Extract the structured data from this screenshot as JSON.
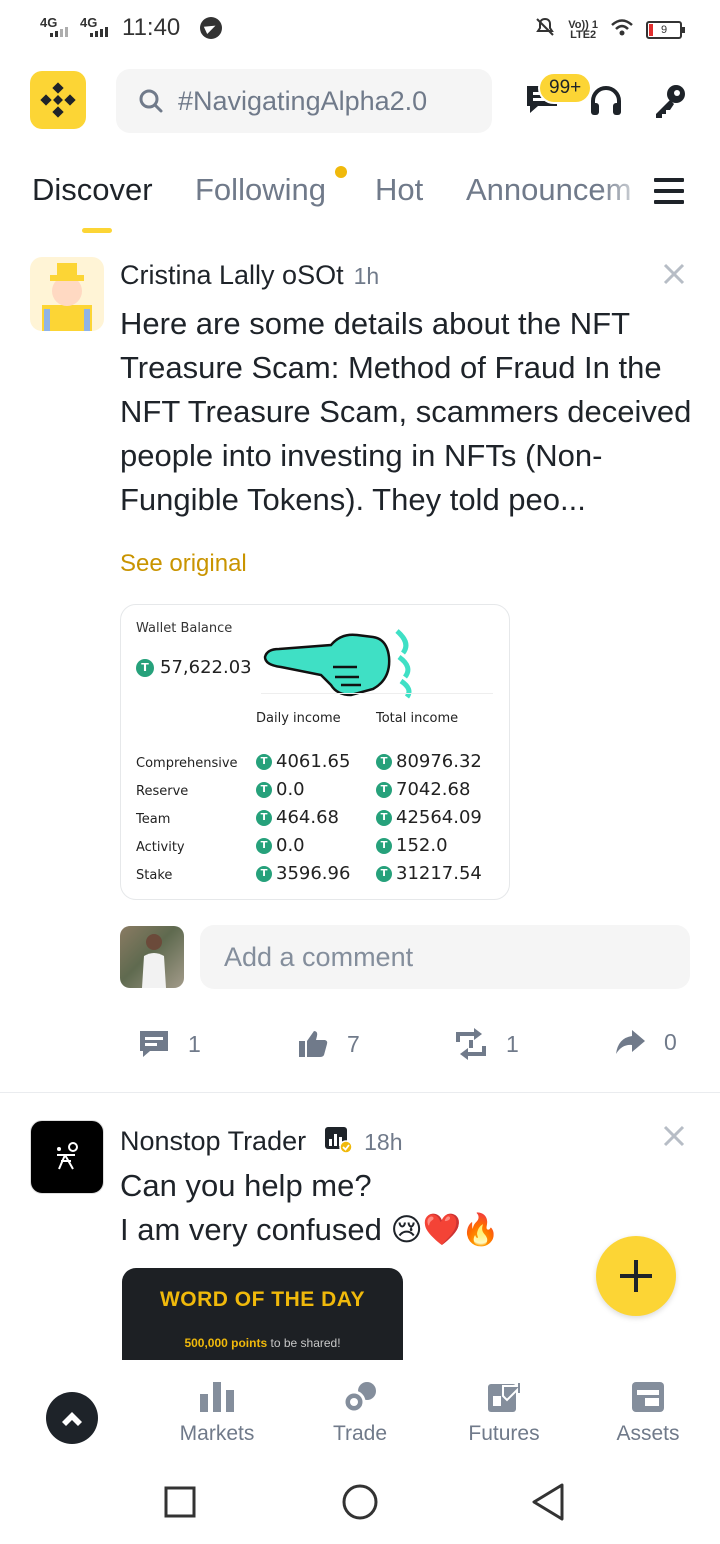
{
  "status_bar": {
    "network1": "4G",
    "network2": "4G",
    "time": "11:40",
    "volte_line1": "Vo)) 1",
    "volte_line2": "LTE2",
    "battery": "9"
  },
  "header": {
    "search_placeholder": "#NavigatingAlpha2.0",
    "notification_badge": "99+"
  },
  "tabs": [
    {
      "label": "Discover",
      "active": true
    },
    {
      "label": "Following",
      "active": false,
      "has_dot": true
    },
    {
      "label": "Hot",
      "active": false
    },
    {
      "label": "Announcem",
      "active": false
    }
  ],
  "posts": [
    {
      "author": "Cristina Lally oSOt",
      "time": "1h",
      "text": "Here are some details about the NFT Treasure Scam: Method of Fraud In the NFT Treasure Scam, scammers deceived people into investing in NFTs (Non-Fungible Tokens). They told peo...",
      "see_original": "See original",
      "wallet_card": {
        "title": "Wallet Balance",
        "balance": "57,622.03",
        "col_daily": "Daily income",
        "col_total": "Total income",
        "tether_symbol": "T",
        "rows": [
          {
            "label": "Comprehensive",
            "daily": "4061.65",
            "total": "80976.32"
          },
          {
            "label": "Reserve",
            "daily": "0.0",
            "total": "7042.68"
          },
          {
            "label": "Team",
            "daily": "464.68",
            "total": "42564.09"
          },
          {
            "label": "Activity",
            "daily": "0.0",
            "total": "152.0"
          },
          {
            "label": "Stake",
            "daily": "3596.96",
            "total": "31217.54"
          }
        ]
      },
      "comment_placeholder": "Add a comment",
      "actions": {
        "comments": "1",
        "likes": "7",
        "reposts": "1",
        "shares": "0"
      }
    },
    {
      "author": "Nonstop Trader",
      "time": "18h",
      "text_line1": "Can you help me?",
      "text_line2": "I am very confused 😢❤️🔥",
      "image_title": "WORD OF THE DAY",
      "image_sub_points": "500,000 points",
      "image_sub_rest": " to be shared!"
    }
  ],
  "bottom_nav": [
    {
      "label": "Markets",
      "icon": "markets-icon"
    },
    {
      "label": "Trade",
      "icon": "trade-icon"
    },
    {
      "label": "Futures",
      "icon": "futures-icon"
    },
    {
      "label": "Assets",
      "icon": "assets-icon"
    }
  ],
  "colors": {
    "brand_yellow": "#FCD535",
    "link_gold": "#C99400",
    "tether_green": "#26A17B",
    "text_primary": "#1E2329",
    "text_secondary": "#707A8A"
  }
}
